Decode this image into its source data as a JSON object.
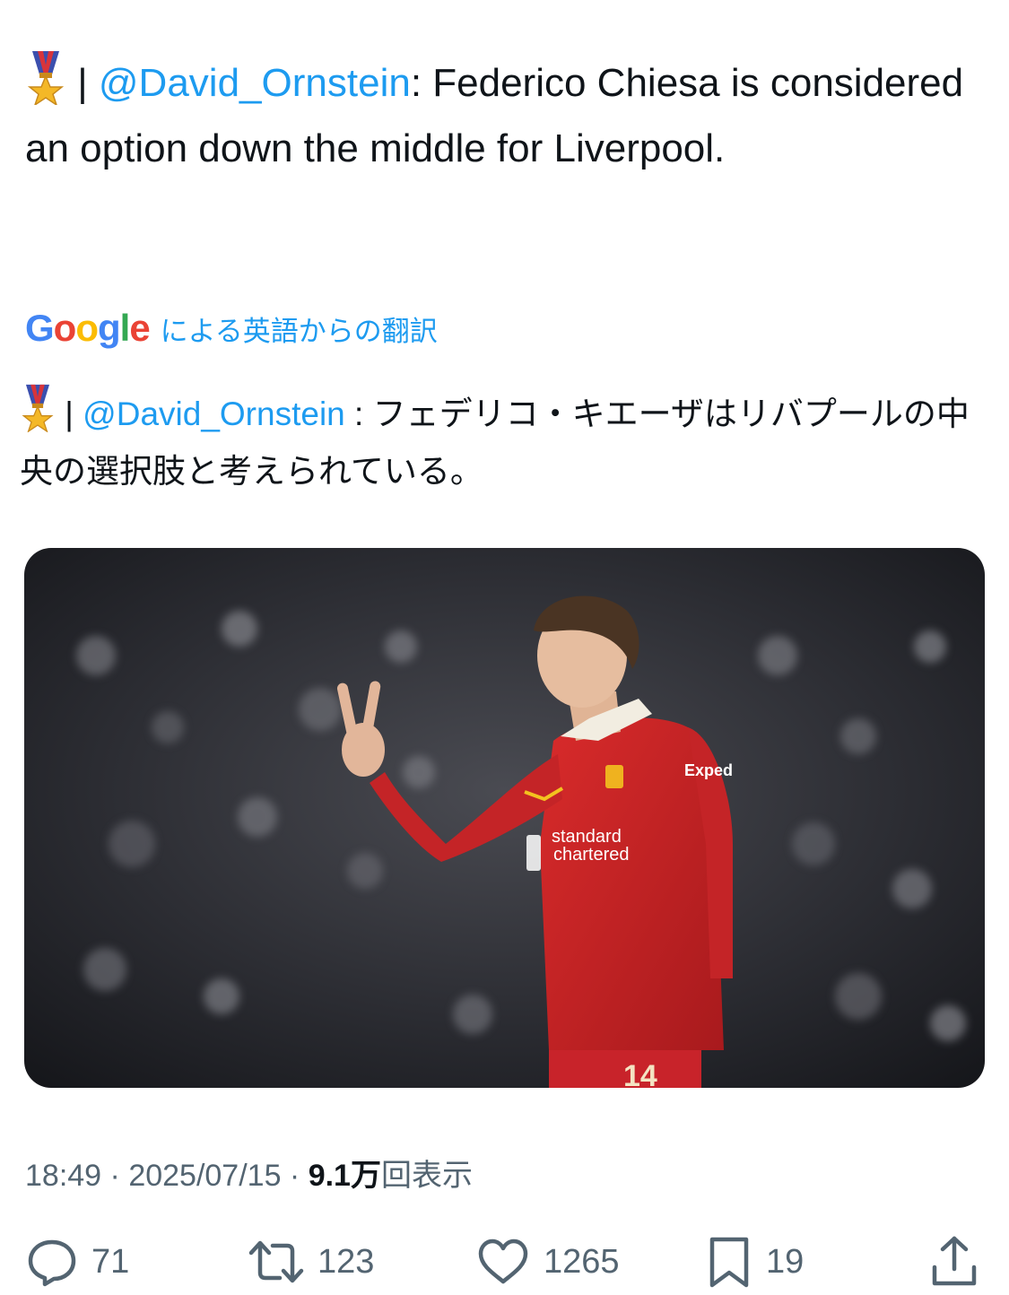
{
  "tweet": {
    "separator": " | ",
    "mention": "@David_Ornstein",
    "body": ": Federico Chiesa is considered an option down the middle for Liverpool.",
    "medal_icon": "military-medal-icon"
  },
  "translation": {
    "logo": {
      "letters": [
        "G",
        "o",
        "o",
        "g",
        "l",
        "e"
      ],
      "colors": [
        "#4285F4",
        "#EA4335",
        "#FBBC05",
        "#4285F4",
        "#34A853",
        "#EA4335"
      ]
    },
    "label": "による英語からの翻訳",
    "separator": " | ",
    "mention": "@David_Ornstein",
    "body": " : フェデリコ・キエーザはリバプールの中央の選択肢と考えられている。"
  },
  "meta": {
    "time": "18:49",
    "dot": " · ",
    "date": "2025/07/15",
    "views_count": "9.1万",
    "views_label": "回表示"
  },
  "actions": {
    "reply_count": "71",
    "retweet_count": "123",
    "like_count": "1265",
    "bookmark_count": "19"
  },
  "colors": {
    "accent": "#1d9bf0",
    "text": "#0f1419",
    "secondary": "#536471"
  }
}
